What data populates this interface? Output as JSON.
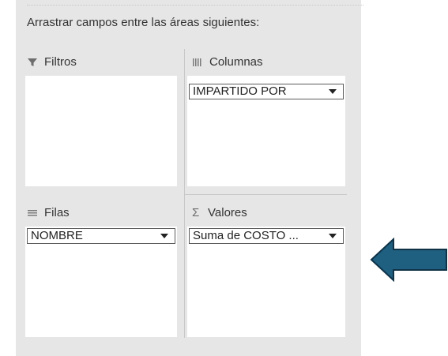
{
  "instructions": "Arrastrar campos entre las áreas siguientes:",
  "areas": {
    "filters": {
      "label": "Filtros",
      "icon": "filter-icon"
    },
    "columns": {
      "label": "Columnas",
      "icon": "columns-icon",
      "fields": [
        "IMPARTIDO POR"
      ]
    },
    "rows": {
      "label": "Filas",
      "icon": "rows-icon",
      "fields": [
        "NOMBRE"
      ]
    },
    "values": {
      "label": "Valores",
      "icon": "sigma-icon",
      "fields": [
        "Suma de COSTO ..."
      ]
    }
  },
  "annotation": {
    "icon": "left-arrow-icon",
    "color": "#1f5f80"
  },
  "colors": {
    "pane_bg": "#e6e6e6",
    "box_bg": "#ffffff"
  }
}
